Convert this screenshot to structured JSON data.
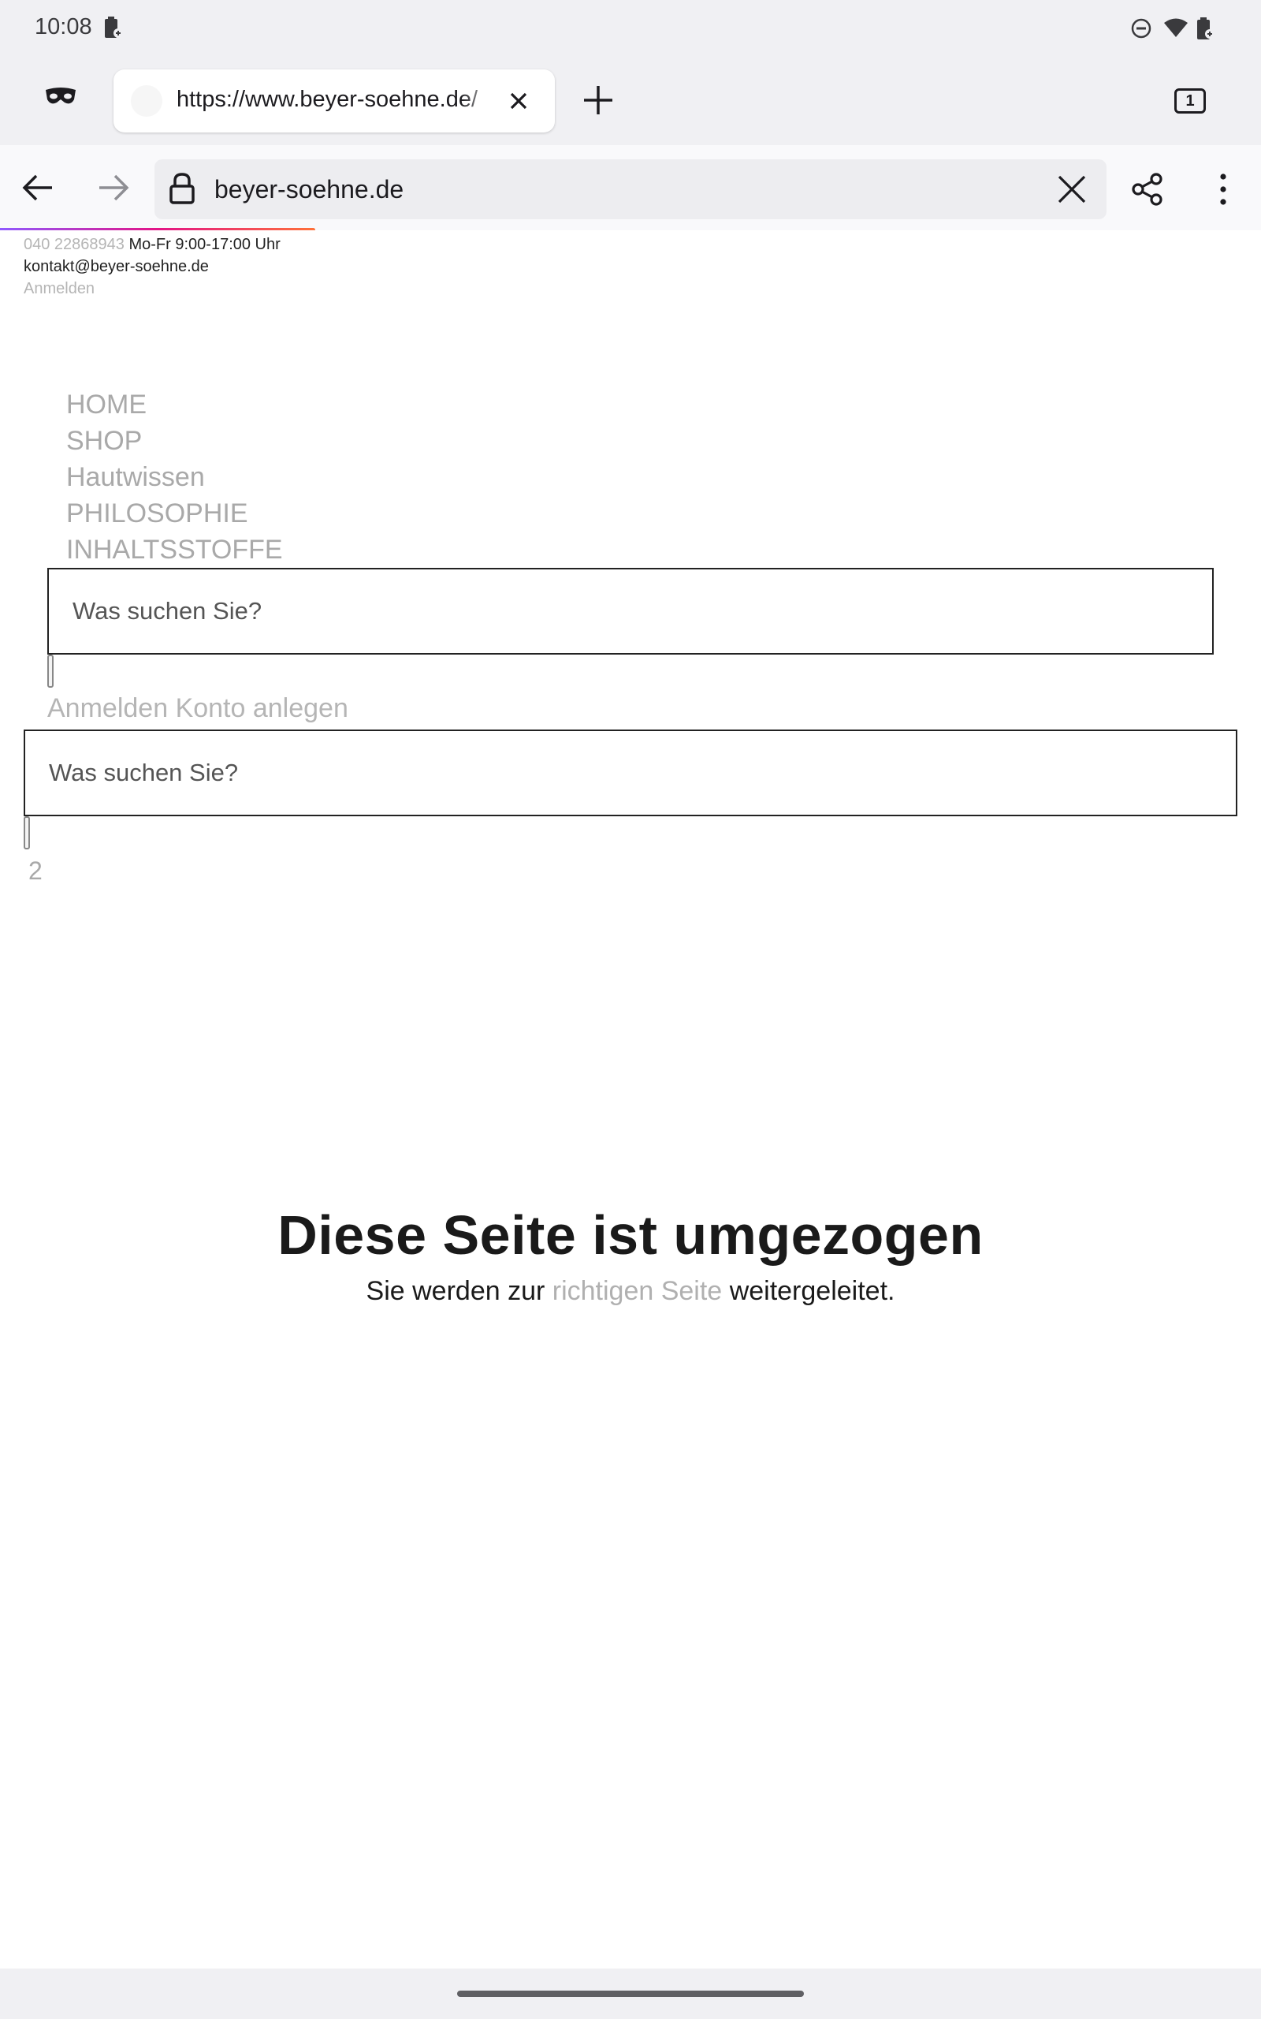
{
  "status_bar": {
    "time": "10:08",
    "icons": [
      "battery-saver-icon",
      "do-not-disturb-icon",
      "wifi-icon",
      "battery-icon"
    ]
  },
  "browser": {
    "tab": {
      "title": "https://www.beyer-soehne.de/",
      "close_icon": "close-icon"
    },
    "tab_count": "1",
    "url": "beyer-soehne.de",
    "icons": [
      "private-mode-icon",
      "add-tab-icon",
      "back-arrow-icon",
      "forward-arrow-icon",
      "lock-icon",
      "clear-url-icon",
      "share-icon",
      "more-menu-icon"
    ],
    "accent_gradient": [
      "#9059ff",
      "#e31587",
      "#ff7139"
    ]
  },
  "page": {
    "top_bar": {
      "phone": "040 22868943",
      "hours": "Mo-Fr 9:00-17:00 Uhr",
      "email": "kontakt@beyer-soehne.de",
      "login": "Anmelden"
    },
    "nav": [
      "HOME",
      "SHOP",
      "Hautwissen",
      "PHILOSOPHIE",
      "INHALTSSTOFFE"
    ],
    "search_placeholder": "Was suchen Sie?",
    "account": {
      "login": "Anmelden",
      "register": "Konto anlegen"
    },
    "cart_count": "2",
    "notice": {
      "title": "Diese Seite ist umgezogen",
      "sub_prefix": "Sie werden zur",
      "sub_link": "richtigen Seite",
      "sub_suffix": "weitergeleitet."
    }
  }
}
